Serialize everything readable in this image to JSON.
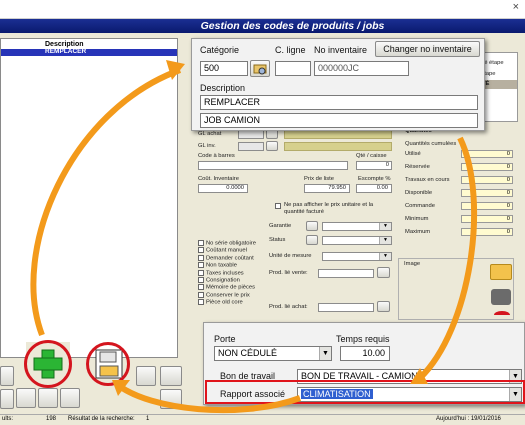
{
  "window": {
    "title": "Gestion des codes de produits / jobs",
    "close_glyph": "×"
  },
  "left_panel": {
    "column_header": "Description",
    "selected_row": "REMPLACER"
  },
  "top_callout": {
    "categorie_label": "Catégorie",
    "categorie_value": "500",
    "cligne_label": "C. ligne",
    "cligne_value": "",
    "noinv_label": "No inventaire",
    "noinv_value": "000000JC",
    "change_button": "Changer no inventaire",
    "desc_label": "Description",
    "desc_value1": "REMPLACER",
    "desc_value2": "JOB CAMION"
  },
  "bg_form": {
    "gl_achat": "GL achat",
    "gl_inv": "GL inv.",
    "code_barre": "Code à barres",
    "qte_caisse": "Qté / caisse",
    "qte_caisse_value": "0",
    "cout_inventaire": "Coût. Inventaire",
    "cout_value": "0.0000",
    "prix_liste": "Prix de liste",
    "prix_value": "79.950",
    "escompte": "Escompte %",
    "escompte_value": "0.00",
    "ne_pas_afficher": "Ne pas afficher le prix unitaire et la quantité facturé",
    "garantie": "Garantie",
    "status": "Status",
    "unite_mesure": "Unité de mesure",
    "prod_lie_vente": "Prod. lié vente:",
    "prod_lie_achat": "Prod. lié achat:",
    "checkboxes": [
      "No série obligatoire",
      "Coûtant manuel",
      "Demander coûtant",
      "Non taxable",
      "Taxes incluses",
      "Consignation",
      "Mémoire de pièces",
      "Conserver le prix",
      "Pièce old core"
    ],
    "right_tab_1": "dé étape",
    "right_tab_2": "étape",
    "right_tab_3": "TÉ",
    "quantities_title": "Quantités",
    "quantities_cumul": "Quantités cumulées",
    "quantities": [
      {
        "label": "Utilisé",
        "value": "0"
      },
      {
        "label": "Réservée",
        "value": "0"
      },
      {
        "label": "Travaux en cours",
        "value": "0"
      },
      {
        "label": "Disponible",
        "value": "0"
      },
      {
        "label": "Commande",
        "value": "0"
      },
      {
        "label": "Minimum",
        "value": "0"
      },
      {
        "label": "Maximum",
        "value": "0"
      }
    ],
    "image_label": "Image"
  },
  "bottom_callout": {
    "porte_label": "Porte",
    "porte_value": "NON CÉDULÉ",
    "temps_label": "Temps requis",
    "temps_value": "10.00",
    "bon_label": "Bon de travail",
    "bon_value": "BON DE TRAVAIL - CAMION",
    "rapport_label": "Rapport associé",
    "rapport_value": "CLIMATISATION"
  },
  "status_bar": {
    "left": "ults:",
    "count": "198",
    "search_label": "Résultat de la recherche:",
    "search_value": "1",
    "date": "Aujourd'hui : 19/01/2016"
  },
  "colors": {
    "header": "#0a1a6e",
    "accent_orange": "#f39a1b",
    "highlight_red": "#e0141b",
    "selection": "#2734b8"
  }
}
